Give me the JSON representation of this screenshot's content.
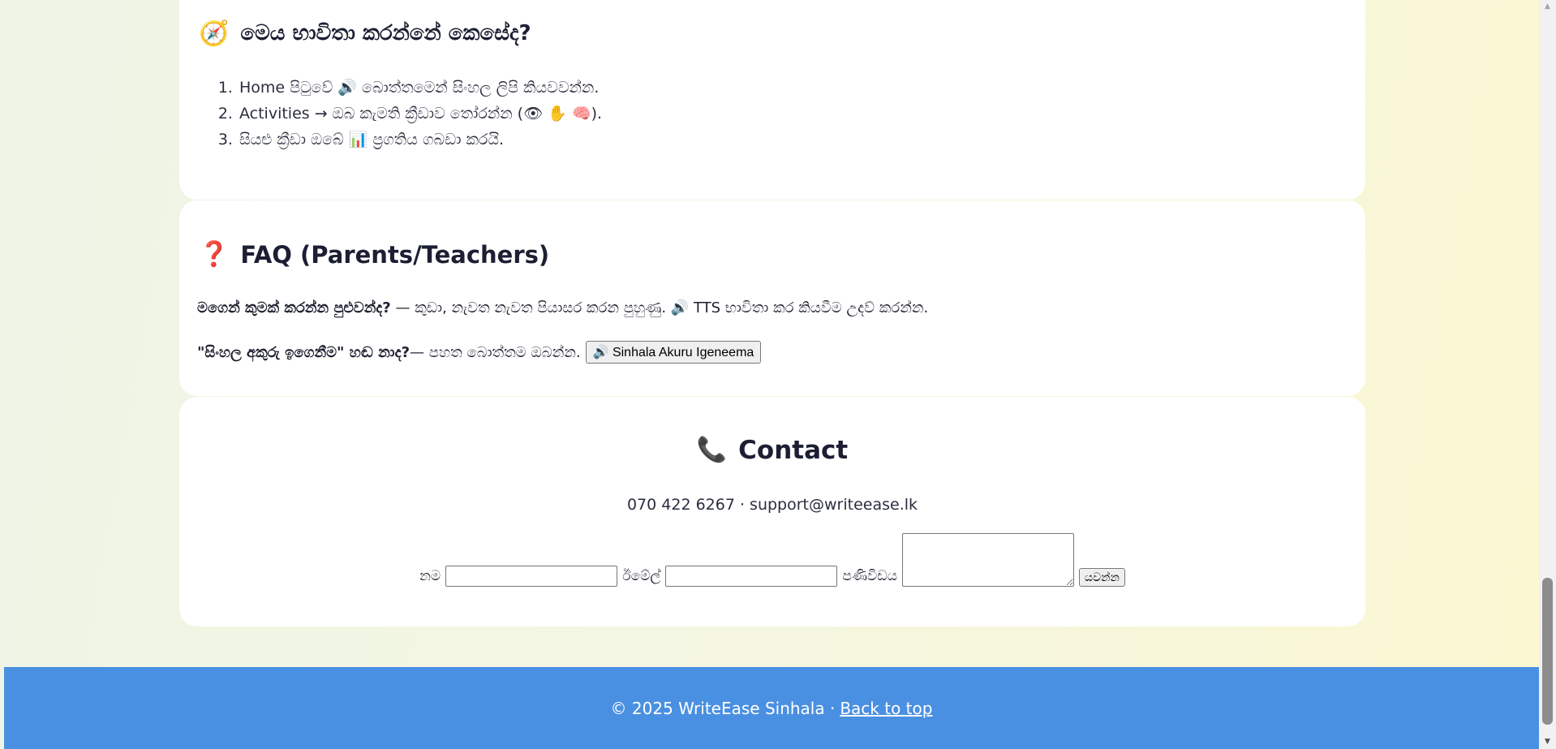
{
  "howto": {
    "icon": "🧭",
    "title": "මෙය භාවිතා කරන්නේ කෙසේද?",
    "steps": [
      "Home පිටුවේ 🔊 බොත්තමෙන් සිංහල ලිපි කියවවන්න.",
      "Activities → ඔබ කැමති ක්‍රීඩාව තෝරන්න (👁 ✋ 🧠).",
      "සියළු ක්‍රීඩා ඔබේ 📊 ප්‍රගතිය ගබඩා කරයි."
    ]
  },
  "faq": {
    "icon": "❓",
    "title": "FAQ (Parents/Teachers)",
    "q1": "මගෙන් කුමක් කරන්න පුළුවන්ද?",
    "a1": " — කුඩා, නැවත නැවත පියාසර කරන පුහුණු. 🔊 TTS භාවිතා කර කියවීම උදව් කරන්න.",
    "q2": "\"සිංහල අකුරු ඉගෙනීම\" හඬ නාද?",
    "a2": " — පහත බොත්තම ඔබන්න.",
    "button_label": "🔊 Sinhala Akuru Igeneema"
  },
  "contact": {
    "icon": "📞",
    "title": "Contact",
    "info": "070 422 6267 · support@writeease.lk",
    "name_label": "නම",
    "email_label": "ඊමේල්",
    "message_label": "පණිවිඩය",
    "submit_label": "යවන්න"
  },
  "footer": {
    "copyright": "© 2025 WriteEase Sinhala ·",
    "back_to_top": "Back to top"
  }
}
